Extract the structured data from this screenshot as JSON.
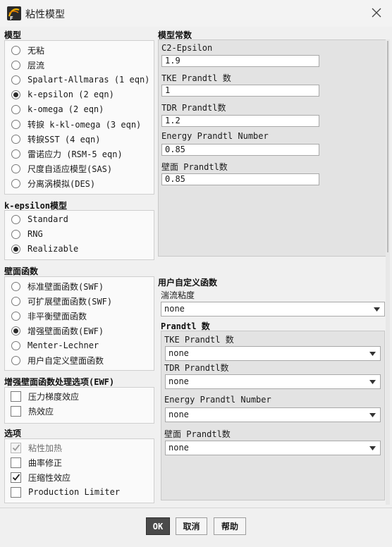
{
  "window": {
    "title": "粘性模型",
    "icons": {
      "app": "fluent-app-icon",
      "close": "close-icon"
    }
  },
  "model": {
    "heading": "模型",
    "options": [
      {
        "label": "无粘",
        "selected": false
      },
      {
        "label": "层流",
        "selected": false
      },
      {
        "label": "Spalart-Allmaras (1 eqn)",
        "selected": false
      },
      {
        "label": "k-epsilon (2 eqn)",
        "selected": true
      },
      {
        "label": "k-omega (2 eqn)",
        "selected": false
      },
      {
        "label": "转捩 k-kl-omega (3 eqn)",
        "selected": false
      },
      {
        "label": "转捩SST (4 eqn)",
        "selected": false
      },
      {
        "label": "雷诺应力 (RSM-5 eqn)",
        "selected": false
      },
      {
        "label": "尺度自适应模型(SAS)",
        "selected": false
      },
      {
        "label": "分离涡模拟(DES)",
        "selected": false
      }
    ]
  },
  "kepsilon": {
    "heading": "k-epsilon模型",
    "options": [
      {
        "label": "Standard",
        "selected": false
      },
      {
        "label": "RNG",
        "selected": false
      },
      {
        "label": "Realizable",
        "selected": true
      }
    ]
  },
  "wall": {
    "heading": "壁面函数",
    "options": [
      {
        "label": "标准壁面函数(SWF)",
        "selected": false
      },
      {
        "label": "可扩展壁面函数(SWF)",
        "selected": false
      },
      {
        "label": "非平衡壁面函数",
        "selected": false
      },
      {
        "label": "增强壁面函数(EWF)",
        "selected": true
      },
      {
        "label": "Menter-Lechner",
        "selected": false
      },
      {
        "label": "用户自定义壁面函数",
        "selected": false
      }
    ]
  },
  "ewf": {
    "heading": "增强壁面函数处理选项(EWF)",
    "options": [
      {
        "label": "压力梯度效应",
        "checked": false
      },
      {
        "label": "热效应",
        "checked": false
      }
    ]
  },
  "opts": {
    "heading": "选项",
    "options": [
      {
        "label": "粘性加热",
        "checked": true,
        "disabled": true
      },
      {
        "label": "曲率修正",
        "checked": false,
        "disabled": false
      },
      {
        "label": "压缩性效应",
        "checked": true,
        "disabled": false
      },
      {
        "label": "Production Limiter",
        "checked": false,
        "disabled": false
      }
    ]
  },
  "constants": {
    "heading": "模型常数",
    "fields": [
      {
        "label": "C2-Epsilon",
        "value": "1.9"
      },
      {
        "label": "TKE Prandtl 数",
        "value": "1"
      },
      {
        "label": "TDR Prandtl数",
        "value": "1.2"
      },
      {
        "label": "Energy Prandtl Number",
        "value": "0.85"
      },
      {
        "label": "壁面 Prandtl数",
        "value": "0.85"
      }
    ]
  },
  "udf": {
    "heading": "用户自定义函数",
    "turb_label": "湍流粘度",
    "turb_value": "none",
    "prandtl_heading": "Prandtl 数",
    "fields": [
      {
        "label": "TKE Prandtl 数",
        "value": "none"
      },
      {
        "label": "TDR Prandtl数",
        "value": "none"
      },
      {
        "label": "Energy Prandtl Number",
        "value": "none"
      },
      {
        "label": "壁面 Prandtl数",
        "value": "none"
      }
    ]
  },
  "buttons": {
    "ok": "OK",
    "cancel": "取消",
    "help": "帮助"
  }
}
